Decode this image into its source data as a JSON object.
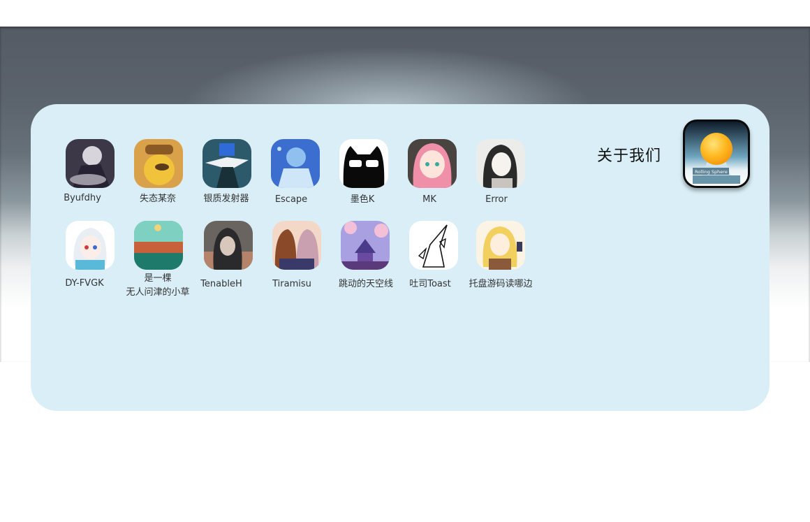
{
  "about": {
    "title": "关于我们"
  },
  "logo": {
    "label": "Rolling Sphere"
  },
  "members": [
    {
      "name": "Byufdhy"
    },
    {
      "name": "失态某奈"
    },
    {
      "name": "银质发射器"
    },
    {
      "name": "Escape"
    },
    {
      "name": "墨色K"
    },
    {
      "name": "MK"
    },
    {
      "name": "Error"
    },
    {
      "name": "DY-FVGK"
    },
    {
      "name": "是一棵\n无人问津的小草"
    },
    {
      "name": "TenableH"
    },
    {
      "name": "Tiramisu"
    },
    {
      "name": "跳动的天空线"
    },
    {
      "name": "吐司Toast"
    },
    {
      "name": "托盘游码读哪边"
    }
  ]
}
